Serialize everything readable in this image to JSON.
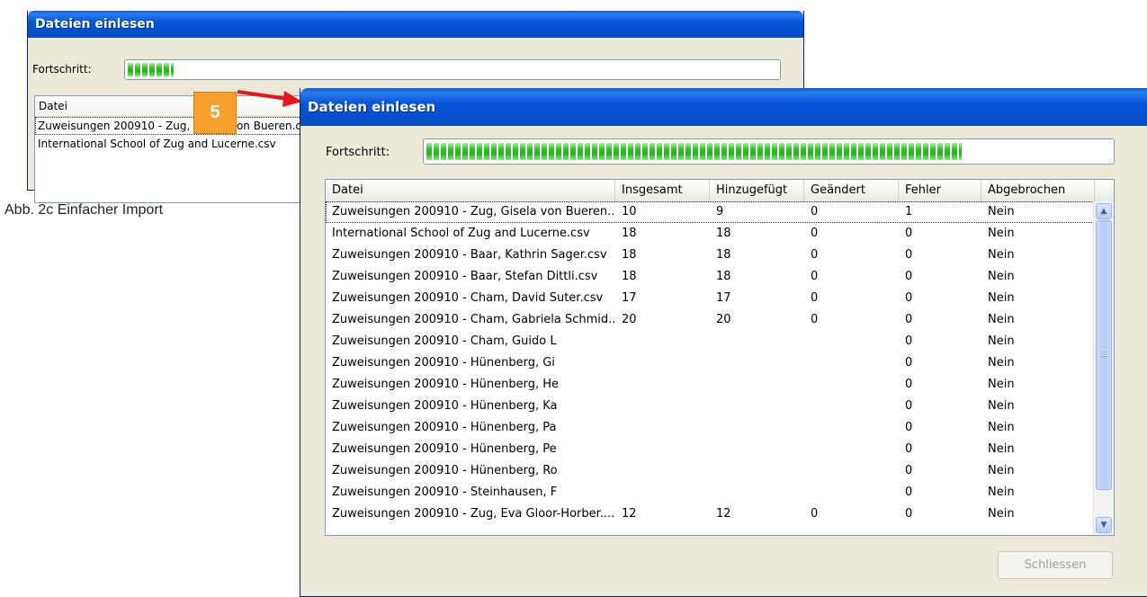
{
  "back_window": {
    "title": "Dateien einlesen",
    "progress_label": "Fortschritt:",
    "progress_fraction": 0.07,
    "list_header": "Datei",
    "files": [
      "Zuweisungen 200910 - Zug, Gisela von Bueren.c",
      "International School of Zug and Lucerne.csv"
    ]
  },
  "callout": {
    "number": "5"
  },
  "caption": "Abb. 2c Einfacher Import",
  "front_window": {
    "title": "Dateien einlesen",
    "progress_label": "Fortschritt:",
    "progress_fraction": 0.78,
    "columns": [
      "Datei",
      "Insgesamt",
      "Hinzugefügt",
      "Geändert",
      "Fehler",
      "Abgebrochen"
    ],
    "rows": [
      [
        "Zuweisungen 200910 - Zug, Gisela von Bueren...",
        "10",
        "9",
        "0",
        "1",
        "Nein"
      ],
      [
        "International School of Zug and Lucerne.csv",
        "18",
        "18",
        "0",
        "0",
        "Nein"
      ],
      [
        "Zuweisungen 200910 - Baar, Kathrin Sager.csv",
        "18",
        "18",
        "0",
        "0",
        "Nein"
      ],
      [
        "Zuweisungen 200910 - Baar, Stefan Dittli.csv",
        "18",
        "18",
        "0",
        "0",
        "Nein"
      ],
      [
        "Zuweisungen 200910 - Cham, David Suter.csv",
        "17",
        "17",
        "0",
        "0",
        "Nein"
      ],
      [
        "Zuweisungen 200910 - Cham, Gabriela Schmid....",
        "20",
        "20",
        "0",
        "0",
        "Nein"
      ],
      [
        "Zuweisungen 200910 - Cham, Guido L",
        "",
        "",
        "",
        "0",
        "Nein"
      ],
      [
        "Zuweisungen 200910 - Hünenberg, Gi",
        "",
        "",
        "",
        "0",
        "Nein"
      ],
      [
        "Zuweisungen 200910 - Hünenberg, He",
        "",
        "",
        "",
        "0",
        "Nein"
      ],
      [
        "Zuweisungen 200910 - Hünenberg, Ka",
        "",
        "",
        "",
        "0",
        "Nein"
      ],
      [
        "Zuweisungen 200910 - Hünenberg, Pa",
        "",
        "",
        "",
        "0",
        "Nein"
      ],
      [
        "Zuweisungen 200910 - Hünenberg, Pe",
        "",
        "",
        "",
        "0",
        "Nein"
      ],
      [
        "Zuweisungen 200910 - Hünenberg, Ro",
        "",
        "",
        "",
        "0",
        "Nein"
      ],
      [
        "Zuweisungen 200910 - Steinhausen, F",
        "",
        "",
        "",
        "0",
        "Nein"
      ],
      [
        "Zuweisungen 200910 - Zug, Eva Gloor-Horber....",
        "12",
        "12",
        "0",
        "0",
        "Nein"
      ]
    ],
    "close_label": "Schliessen"
  },
  "colors": {
    "title_blue": "#0150d0",
    "progress_green": "#22b21a",
    "callout_orange": "#f5a12b",
    "arrow_red": "#e8151b"
  },
  "icons": {
    "scroll_up": "scroll-up-arrow-icon",
    "scroll_down": "scroll-down-arrow-icon"
  }
}
